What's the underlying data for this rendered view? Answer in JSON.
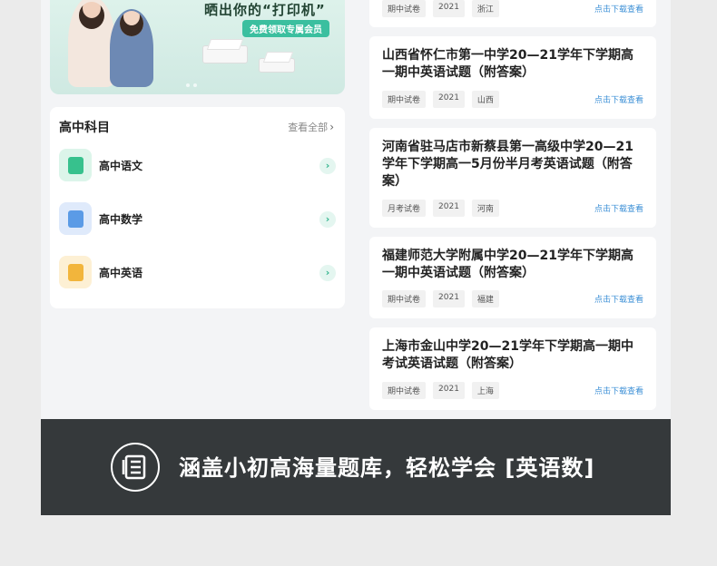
{
  "banner": {
    "title": "晒出你的“打印机”",
    "pill": "免费领取专属会员"
  },
  "subjects": {
    "heading": "高中科目",
    "view_all": "查看全部",
    "items": [
      {
        "label": "高中语文"
      },
      {
        "label": "高中数学"
      },
      {
        "label": "高中英语"
      }
    ]
  },
  "exams": {
    "download_label": "点击下载查看",
    "top_card": {
      "tags": [
        "期中试卷",
        "2021",
        "浙江"
      ]
    },
    "cards": [
      {
        "title": "山西省怀仁市第一中学20—21学年下学期高一期中英语试题（附答案）",
        "tags": [
          "期中试卷",
          "2021",
          "山西"
        ]
      },
      {
        "title": "河南省驻马店市新蔡县第一高级中学20—21学年下学期高一5月份半月考英语试题（附答案）",
        "tags": [
          "月考试卷",
          "2021",
          "河南"
        ]
      },
      {
        "title": "福建师范大学附属中学20—21学年下学期高一期中英语试题（附答案）",
        "tags": [
          "期中试卷",
          "2021",
          "福建"
        ]
      },
      {
        "title": "上海市金山中学20—21学年下学期高一期中考试英语试题（附答案）",
        "tags": [
          "期中试卷",
          "2021",
          "上海"
        ]
      }
    ]
  },
  "band": {
    "text": "涵盖小初高海量题库，轻松学会 [英语数]"
  },
  "colors": {
    "accent": "#35b58f",
    "link": "#3b8fd6",
    "band_bg": "#35393b"
  }
}
